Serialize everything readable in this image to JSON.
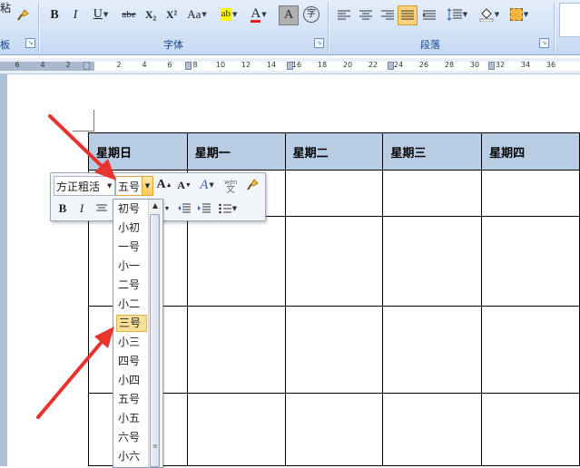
{
  "ribbon": {
    "paste_partial": "粘",
    "clipboard_partial": "板",
    "font_group_label": "字体",
    "paragraph_group_label": "段落",
    "buttons": {
      "bold": "B",
      "italic": "I",
      "underline": "U",
      "strike": "abe",
      "subscript": "X₂",
      "superscript": "X²",
      "change_case": "Aa",
      "highlight": "ab",
      "font_color": "A",
      "char_shade": "A",
      "enclose": "字"
    }
  },
  "ruler": {
    "ticks": [
      "6",
      "4",
      "2",
      "2",
      "4",
      "6",
      "8",
      "10",
      "12",
      "14",
      "16",
      "18",
      "20",
      "22",
      "24",
      "26",
      "28",
      "30",
      "32",
      "34",
      "36"
    ]
  },
  "table": {
    "headers": [
      "星期日",
      "星期一",
      "星期二",
      "星期三",
      "星期四"
    ]
  },
  "mini_toolbar": {
    "font_name": "方正粗活",
    "font_size": "五号",
    "bold": "B",
    "italic": "I"
  },
  "size_list": {
    "items": [
      "初号",
      "小初",
      "一号",
      "小一",
      "二号",
      "小二",
      "三号",
      "小三",
      "四号",
      "小四",
      "五号",
      "小五",
      "六号",
      "小六"
    ],
    "selected_index": 6
  },
  "colors": {
    "ribbon_bg": "#d4e3f7",
    "table_header_bg": "#b8cce4",
    "selected_item_bg": "#fbe09a",
    "annotation_arrow": "#e8342d"
  }
}
